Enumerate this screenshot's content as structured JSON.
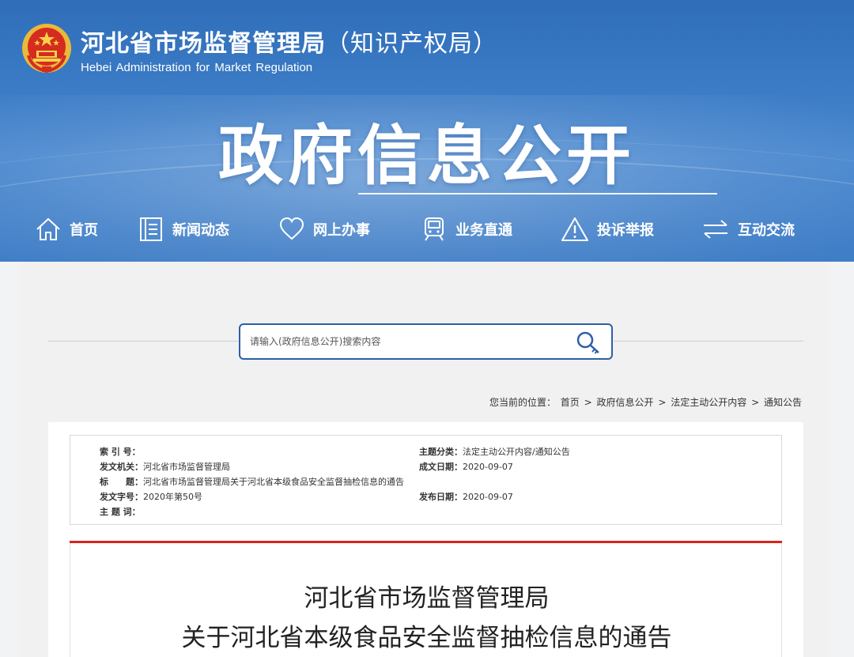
{
  "site": {
    "name": "河北省市场监督管理局",
    "name_sub": "（知识产权局）",
    "name_en": "Hebei Administration for Market Regulation",
    "banner_title": "政府信息公开"
  },
  "nav": {
    "items": [
      {
        "label": "首页",
        "icon": "home-icon"
      },
      {
        "label": "新闻动态",
        "icon": "news-icon"
      },
      {
        "label": "网上办事",
        "icon": "heart-icon"
      },
      {
        "label": "业务直通",
        "icon": "train-icon"
      },
      {
        "label": "投诉举报",
        "icon": "warning-icon"
      },
      {
        "label": "互动交流",
        "icon": "exchange-icon"
      }
    ]
  },
  "search": {
    "placeholder": "请输入(政府信息公开)搜索内容"
  },
  "breadcrumb": {
    "prefix": "您当前的位置：",
    "items": [
      "首页",
      "政府信息公开",
      "法定主动公开内容",
      "通知公告"
    ],
    "separator": ">"
  },
  "meta": {
    "index_label": "索 引 号：",
    "index_value": "",
    "issuer_label": "发文机关：",
    "issuer_value": "河北省市场监督管理局",
    "title_label": "标　　题：",
    "title_value": "河北省市场监督管理局关于河北省本级食品安全监督抽检信息的通告",
    "docno_label": "发文字号：",
    "docno_value": "2020年第50号",
    "keywords_label": "主 题 词：",
    "keywords_value": "",
    "category_label": "主题分类：",
    "category_value": "法定主动公开内容/通知公告",
    "created_label": "成文日期：",
    "created_value": "2020-09-07",
    "published_label": "发布日期：",
    "published_value": "2020-09-07"
  },
  "article": {
    "title_line1": "河北省市场监督管理局",
    "title_line2": "关于河北省本级食品安全监督抽检信息的通告"
  },
  "colors": {
    "header_blue": "#3c7cc6",
    "search_border": "#2d5fa8",
    "red_rule": "#d9251d"
  }
}
